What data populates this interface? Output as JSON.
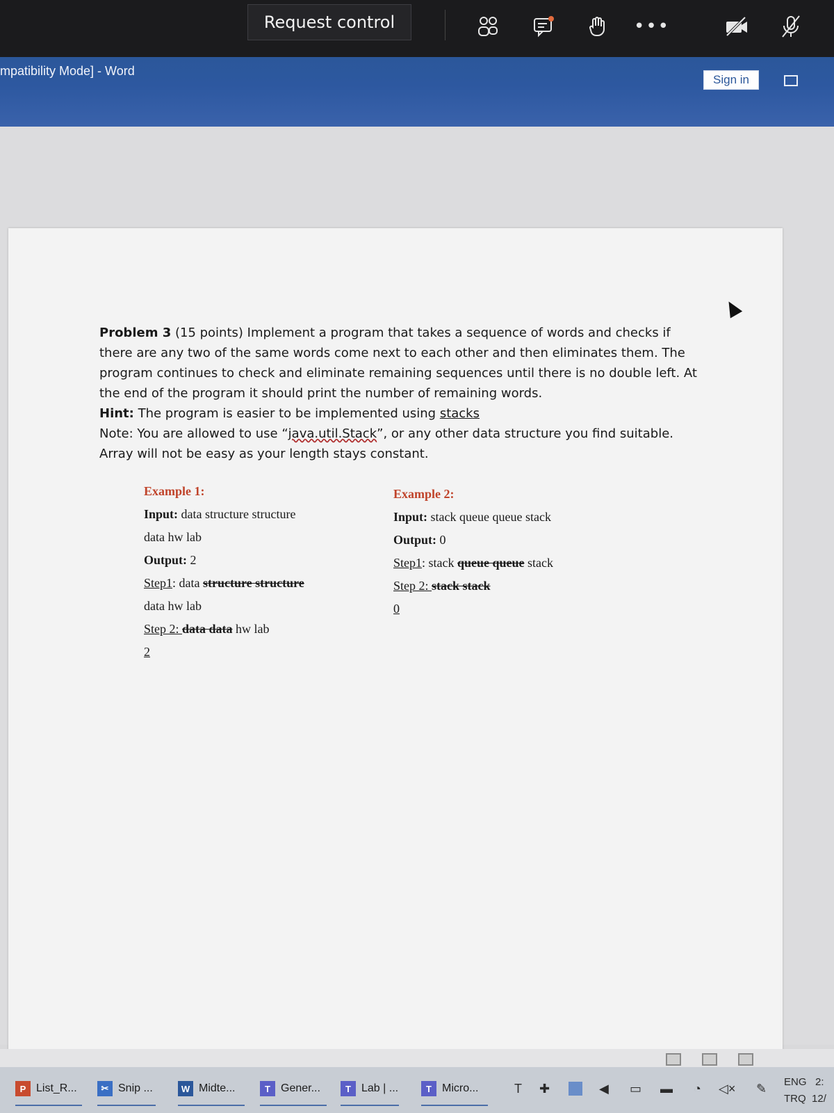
{
  "teams": {
    "request_control": "Request control",
    "icons": [
      "people-icon",
      "chat-icon",
      "raise-hand-icon",
      "more-icon",
      "camera-off-icon",
      "mic-off-icon"
    ]
  },
  "word": {
    "title": "mpatibility Mode]  -  Word",
    "sign_in": "Sign in"
  },
  "document": {
    "problem_label": "Problem 3",
    "problem_points": " (15 points) Implement a program that takes a sequence of words and checks if there are any two of the same words come next to each other and then eliminates them. The program continues to check and eliminate remaining sequences until there is no double left. At the end of the program it should print the number of remaining words.",
    "hint_label": "Hint:",
    "hint_text": " The program is easier to be implemented using ",
    "hint_link": "stacks",
    "note_pre": "Note: You are allowed to use “",
    "note_code": "java.util.Stack",
    "note_post": "”, or any other data structure you find suitable. Array will not be easy as your length stays constant.",
    "example1": {
      "title": "Example 1:",
      "input_label": "Input:",
      "input_text": " data structure structure",
      "input_cont": "data hw lab",
      "output_label": "Output:",
      "output_text": " 2",
      "step1_label": "Step1",
      "step1_pre": ": data ",
      "step1_struck": "structure structure",
      "step1_cont": "data hw lab",
      "step2_label": "Step 2: ",
      "step2_struck": "data data",
      "step2_post": " hw lab",
      "result": "2"
    },
    "example2": {
      "title": "Example 2:",
      "input_label": "Input:",
      "input_text": " stack queue queue stack",
      "output_label": "Output:",
      "output_text": " 0",
      "step1_label": "Step1",
      "step1_pre": ": stack ",
      "step1_struck": "queue  queue",
      "step1_post": " stack",
      "step2_label": "Step 2: ",
      "step2_struck": "stack stack",
      "result": "0"
    }
  },
  "taskbar": {
    "items": [
      {
        "label": "List_R...",
        "icon": "P",
        "color": "#c84b2f"
      },
      {
        "label": "Snip ...",
        "icon": "✂",
        "color": "#3a6fc4"
      },
      {
        "label": "Midte...",
        "icon": "W",
        "color": "#2b579a"
      },
      {
        "label": "Gener...",
        "icon": "T",
        "color": "#5b5fc7"
      },
      {
        "label": "Lab | ...",
        "icon": "T",
        "color": "#5b5fc7"
      },
      {
        "label": "Micro...",
        "icon": "T",
        "color": "#5b5fc7"
      }
    ],
    "lang": "ENG",
    "layout": "TRQ",
    "time": "2:",
    "date": "12/"
  }
}
